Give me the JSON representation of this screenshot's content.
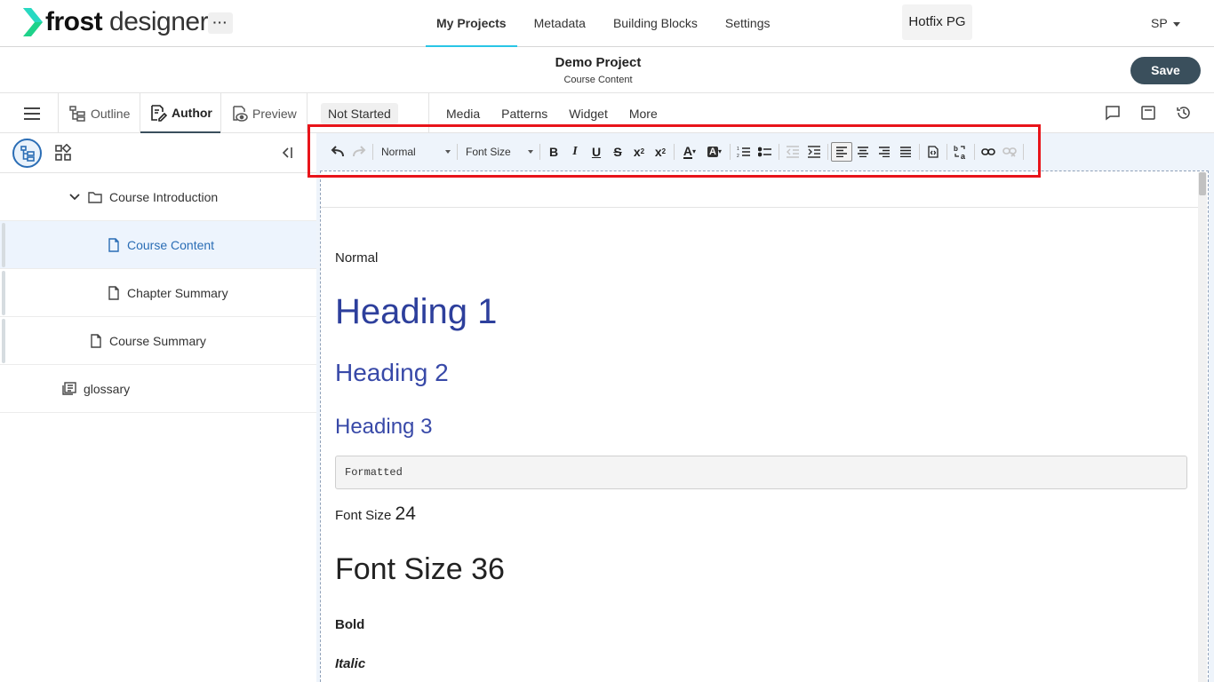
{
  "app": {
    "logo_bold": "frost",
    "logo_light": " designer",
    "more": "···",
    "nav": [
      "My Projects",
      "Metadata",
      "Building Blocks",
      "Settings"
    ],
    "workspace": "Hotfix PG",
    "user": "SP"
  },
  "project": {
    "title": "Demo Project",
    "subtitle": "Course Content",
    "save_label": "Save"
  },
  "tabs": {
    "outline": "Outline",
    "author": "Author",
    "preview": "Preview",
    "status": "Not Started",
    "menu": [
      "Media",
      "Patterns",
      "Widget",
      "More"
    ]
  },
  "tree": [
    {
      "label": "Course Introduction",
      "type": "folder"
    },
    {
      "label": "Course Content",
      "type": "page",
      "selected": true
    },
    {
      "label": "Chapter Summary",
      "type": "page"
    },
    {
      "label": "Course Summary",
      "type": "page"
    },
    {
      "label": "glossary",
      "type": "glossary"
    }
  ],
  "toolbar": {
    "paragraph_format": "Normal",
    "font_size": "Font Size",
    "buttons": [
      "undo",
      "redo",
      "bold",
      "italic",
      "underline",
      "strikethrough",
      "subscript",
      "superscript",
      "text-color",
      "background-color",
      "numbered-list",
      "bulleted-list",
      "outdent",
      "indent",
      "align-left",
      "align-center",
      "align-right",
      "justify",
      "source",
      "language",
      "link",
      "unlink"
    ]
  },
  "content": {
    "normal": "Normal",
    "heading1": "Heading 1",
    "heading2": "Heading 2",
    "heading3": "Heading 3",
    "formatted": "Formatted",
    "fontsize24_prefix": "Font Size ",
    "fontsize24_num": "24",
    "fontsize36": "Font Size 36",
    "bold": "Bold",
    "italic": "Italic"
  },
  "colors": {
    "accent": "#29c5e6",
    "save": "#3a4f5c",
    "heading": "#2d3f9c",
    "selected": "#2a6db5",
    "highlight": "#e8141a"
  }
}
